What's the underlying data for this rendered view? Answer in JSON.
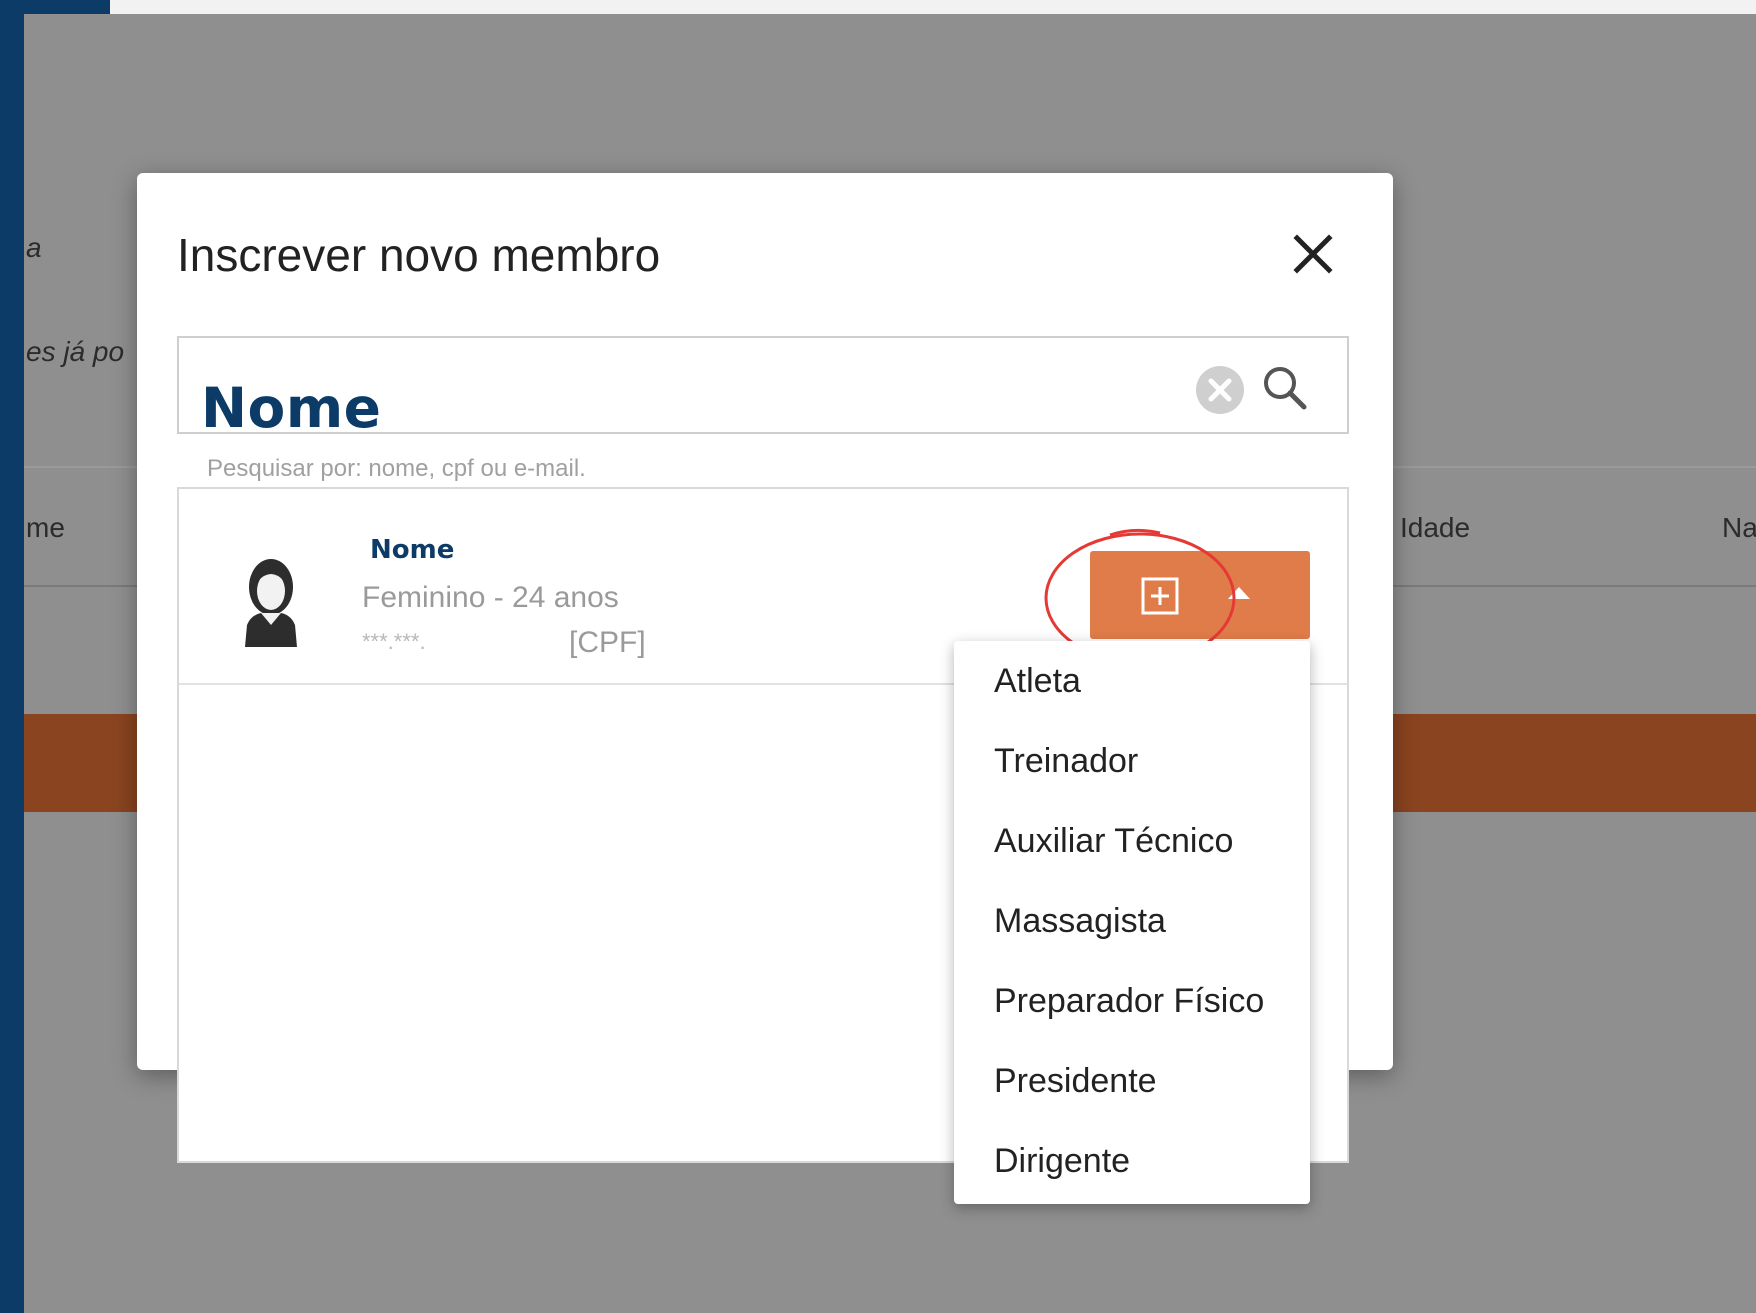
{
  "background": {
    "partial_text_1": "a",
    "partial_text_2": "es já po",
    "col_nome": "me",
    "col_idade": "Idade",
    "col_na": "Na"
  },
  "modal": {
    "title": "Inscrever novo membro",
    "search": {
      "value": "Nome",
      "hint": "Pesquisar por: nome, cpf ou e-mail."
    },
    "result": {
      "name": "Nome",
      "info": "Feminino - 24 anos",
      "cpf_mask": "***.***.",
      "cpf_label": "[CPF]"
    },
    "roles": [
      "Atleta",
      "Treinador",
      "Auxiliar Técnico",
      "Massagista",
      "Preparador Físico",
      "Presidente",
      "Dirigente"
    ]
  },
  "colors": {
    "brand_blue": "#0b3b66",
    "accent_orange": "#e07c4a",
    "highlight_red": "#e53935"
  },
  "icons": [
    "close-icon",
    "clear-icon",
    "search-icon",
    "avatar-female-icon",
    "plus-box-icon",
    "caret-up-icon"
  ]
}
